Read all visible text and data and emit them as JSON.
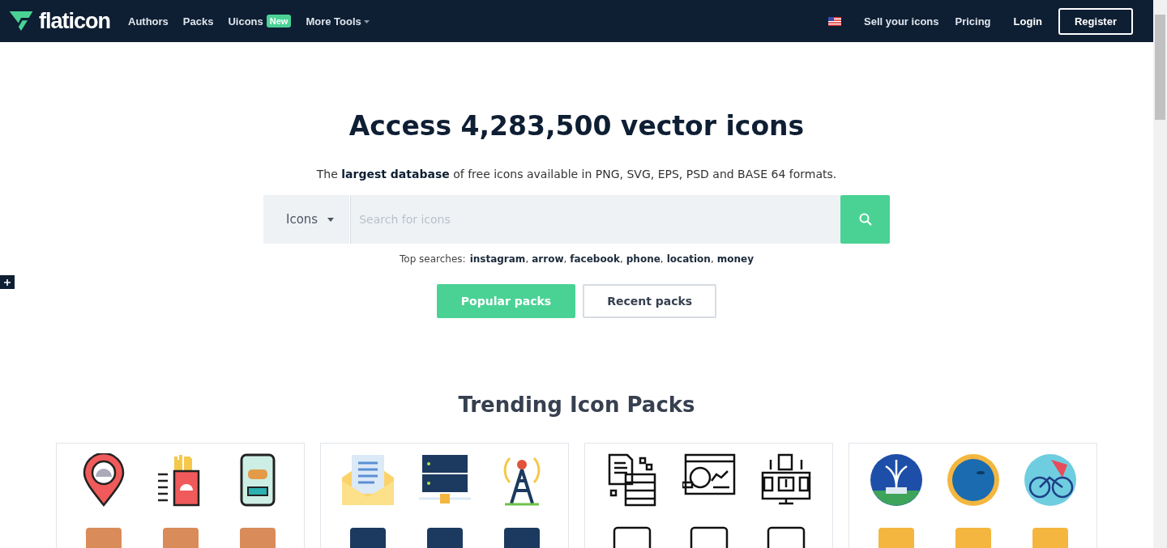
{
  "header": {
    "logo": "flaticon",
    "nav": [
      {
        "label": "Authors",
        "dropdown": false
      },
      {
        "label": "Packs",
        "dropdown": false
      },
      {
        "label": "Uicons",
        "badge": "New",
        "dropdown": false
      },
      {
        "label": "More Tools",
        "dropdown": true
      }
    ],
    "right_links": [
      "Sell your icons",
      "Pricing"
    ],
    "login": "Login",
    "register": "Register"
  },
  "hero": {
    "title": "Access 4,283,500 vector icons",
    "subtitle": "The **largest database** of free icons available in PNG, SVG, EPS, PSD and BASE 64 formats.",
    "search": {
      "type": "Icons",
      "placeholder": "Search for icons"
    },
    "top_searches": {
      "label": "Top searches:",
      "separator": ",",
      "links": [
        "instagram",
        "arrow",
        "facebook",
        "phone",
        "location",
        "money"
      ]
    },
    "buttons": [
      {
        "label": "Popular packs",
        "selected": true
      },
      {
        "label": "Recent packs",
        "selected": false
      }
    ]
  },
  "trending": {
    "title": "Trending Icon Packs"
  }
}
